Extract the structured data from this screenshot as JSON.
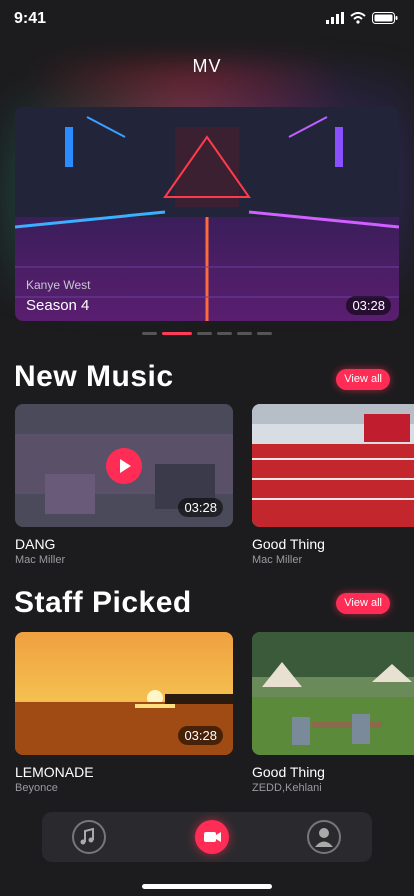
{
  "status_bar": {
    "time": "9:41"
  },
  "header": {
    "title": "MV"
  },
  "hero": {
    "artist": "Kanye West",
    "title": "Season 4",
    "duration": "03:28"
  },
  "carousel": {
    "pages": 6,
    "active_index": 1
  },
  "sections": [
    {
      "title": "New Music",
      "view_all": "View all",
      "items": [
        {
          "title": "DANG",
          "artist": "Mac Miller",
          "duration": "03:28"
        },
        {
          "title": "Good Thing",
          "artist": "Mac Miller"
        }
      ]
    },
    {
      "title": "Staff Picked",
      "view_all": "View all",
      "items": [
        {
          "title": "LEMONADE",
          "artist": "Beyonce",
          "duration": "03:28"
        },
        {
          "title": "Good Thing",
          "artist": "ZEDD,Kehlani"
        }
      ]
    }
  ],
  "tab_bar": {
    "items": [
      {
        "icon": "music-note-icon",
        "active": false
      },
      {
        "icon": "video-camera-icon",
        "active": true
      },
      {
        "icon": "profile-icon",
        "active": false
      }
    ]
  },
  "colors": {
    "accent": "#ff2d55",
    "background": "#1c1c1e"
  }
}
